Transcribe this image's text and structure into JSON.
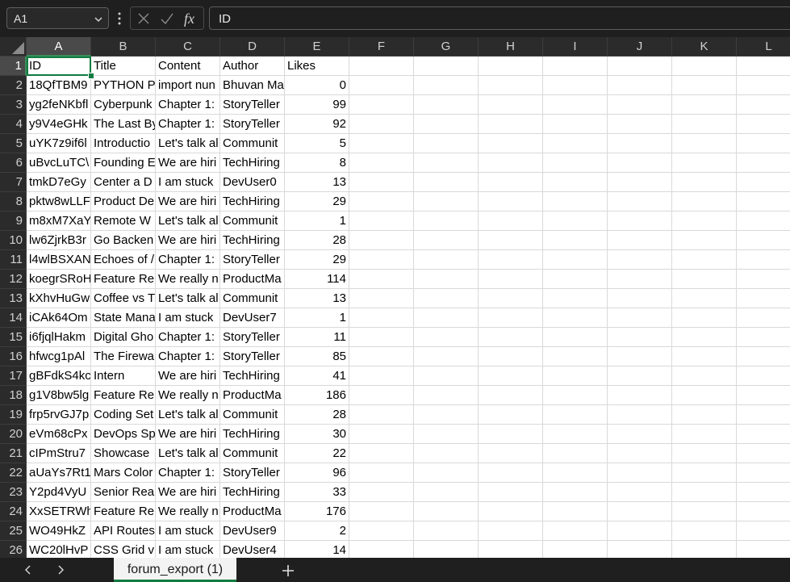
{
  "formula_bar": {
    "name_box": "A1",
    "formula": "ID",
    "icons": [
      "chevron-down-icon",
      "more-dots-icon",
      "cancel-icon",
      "confirm-icon",
      "function-icon"
    ]
  },
  "columns": [
    "A",
    "B",
    "C",
    "D",
    "E",
    "F",
    "G",
    "H",
    "I",
    "J",
    "K",
    "L"
  ],
  "rows": [
    [
      "ID",
      "Title",
      "Content",
      "Author",
      "Likes"
    ],
    [
      "18QfTBM9",
      "PYTHON P",
      "import nun",
      "Bhuvan Ma",
      "0"
    ],
    [
      "yg2feNKbfl",
      "Cyberpunk",
      "Chapter 1:",
      "StoryTeller",
      "99"
    ],
    [
      "y9V4eGHk",
      "The Last By",
      "Chapter 1:",
      "StoryTeller",
      "92"
    ],
    [
      "uYK7z9if6l",
      "Introductio",
      "Let's talk al",
      "Communit",
      "5"
    ],
    [
      "uBvcLuTC\\",
      "Founding E",
      "We are hiri",
      "TechHiring",
      "8"
    ],
    [
      "tmkD7eGy",
      "Center a D",
      "I am stuck",
      "DevUser0",
      "13"
    ],
    [
      "pktw8wLLF",
      "Product De",
      "We are hiri",
      "TechHiring",
      "29"
    ],
    [
      "m8xM7XaY",
      "Remote W",
      "Let's talk al",
      "Communit",
      "1"
    ],
    [
      "lw6ZjrkB3r",
      "Go Backen",
      "We are hiri",
      "TechHiring",
      "28"
    ],
    [
      "l4wlBSXAN",
      "Echoes of /",
      "Chapter 1:",
      "StoryTeller",
      "29"
    ],
    [
      "koegrSRoH",
      "Feature Re",
      "We really n",
      "ProductMa",
      "114"
    ],
    [
      "kXhvHuGw",
      "Coffee vs T",
      "Let's talk al",
      "Communit",
      "13"
    ],
    [
      "iCAk64Om",
      "State Mana",
      "I am stuck",
      "DevUser7",
      "1"
    ],
    [
      "i6fjqlHakm",
      "Digital Gho",
      "Chapter 1:",
      "StoryTeller",
      "11"
    ],
    [
      "hfwcg1pAl",
      "The Firewa",
      "Chapter 1:",
      "StoryTeller",
      "85"
    ],
    [
      "gBFdkS4kc",
      "Intern",
      "We are hiri",
      "TechHiring",
      "41"
    ],
    [
      "g1V8bw5lg",
      "Feature Re",
      "We really n",
      "ProductMa",
      "186"
    ],
    [
      "frp5rvGJ7p",
      "Coding Set",
      "Let's talk al",
      "Communit",
      "28"
    ],
    [
      "eVm68cPx",
      "DevOps Sp",
      "We are hiri",
      "TechHiring",
      "30"
    ],
    [
      "cIPmStru7",
      "Showcase",
      "Let's talk al",
      "Communit",
      "22"
    ],
    [
      "aUaYs7Rt1",
      "Mars Color",
      "Chapter 1:",
      "StoryTeller",
      "96"
    ],
    [
      "Y2pd4VyU",
      "Senior Rea",
      "We are hiri",
      "TechHiring",
      "33"
    ],
    [
      "XxSETRWh",
      "Feature Re",
      "We really n",
      "ProductMa",
      "176"
    ],
    [
      "WO49HkZ",
      "API Routes",
      "I am stuck",
      "DevUser9",
      "2"
    ],
    [
      "WC20lHvP",
      "CSS Grid v",
      "I am stuck",
      "DevUser4",
      "14"
    ]
  ],
  "sheet_tabs": {
    "active": "forum_export (1)",
    "add_label": "+"
  },
  "colors": {
    "accent": "#107c41",
    "chrome": "#1f1f1f",
    "header": "#2b2b2b"
  }
}
